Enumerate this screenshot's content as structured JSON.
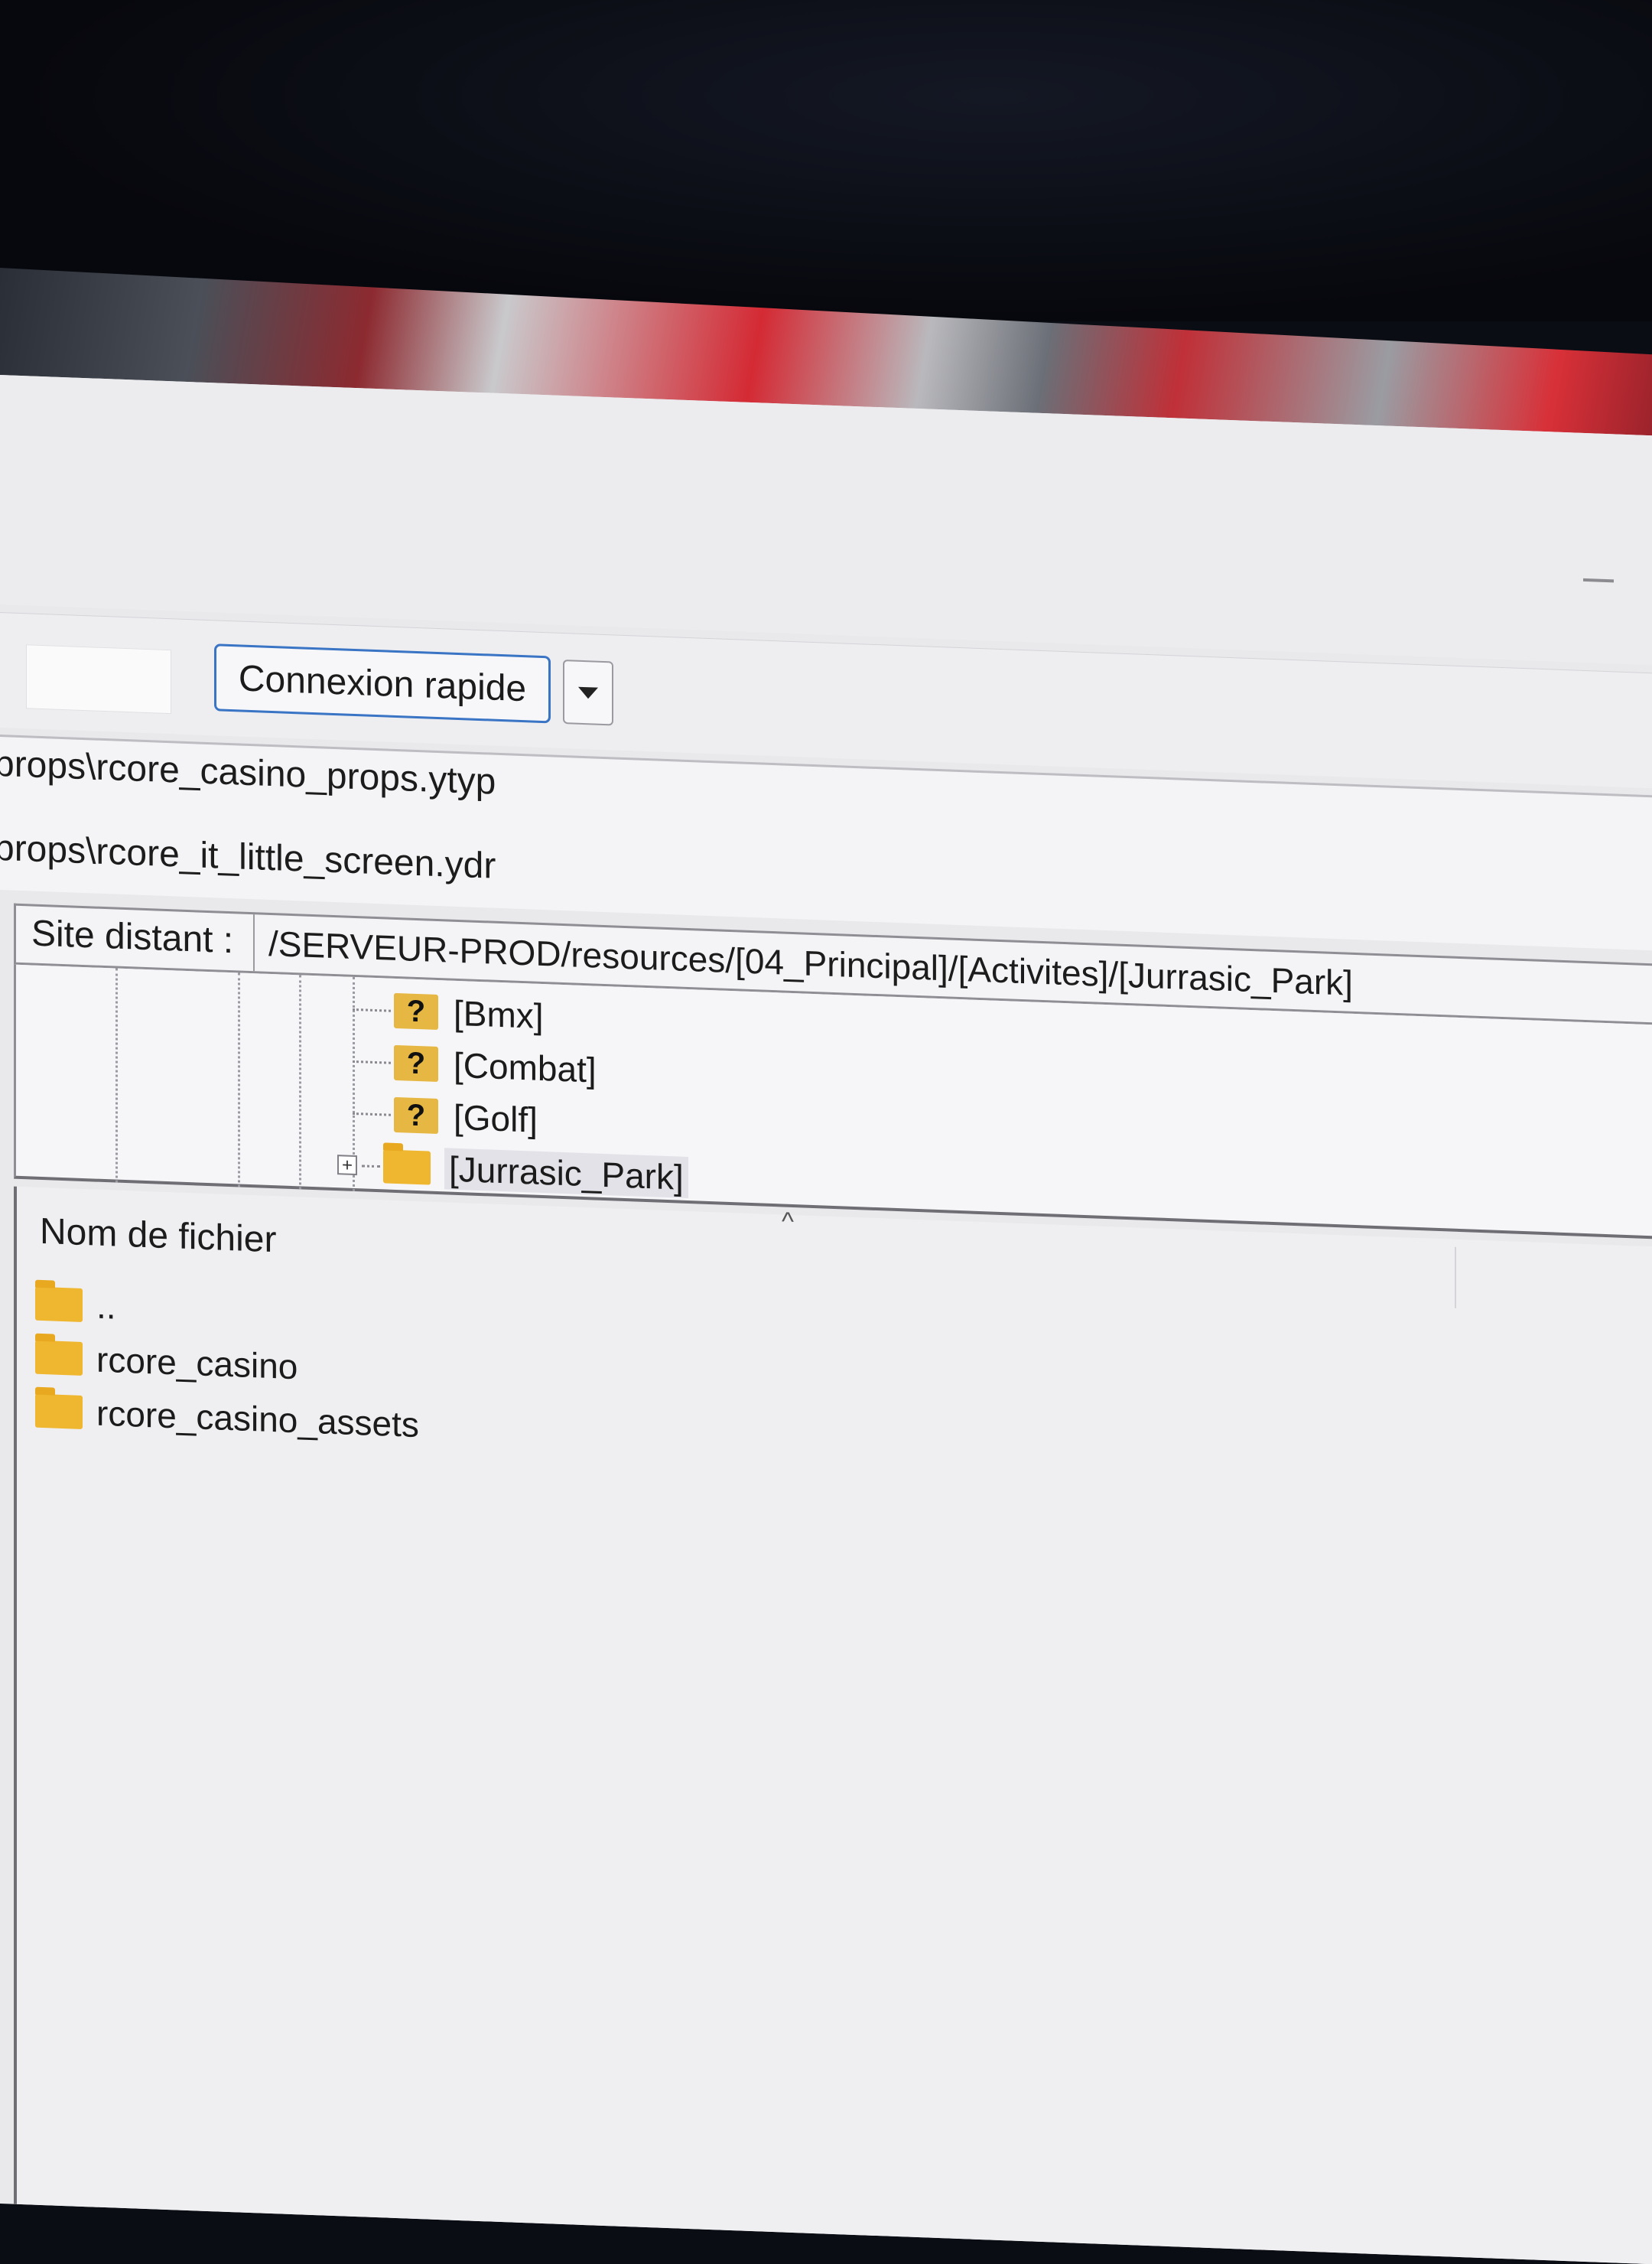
{
  "toolbar": {
    "quickconnect_label": "Connexion rapide"
  },
  "log": {
    "lines": [
      "props\\rcore_casino_props.ytyp",
      "props\\rcore_it_little_screen.ydr"
    ]
  },
  "remote": {
    "label": "Site distant :",
    "path": "/SERVEUR-PROD/resources/[04_Principal]/[Activites]/[Jurrasic_Park]"
  },
  "tree": {
    "items": [
      {
        "label": "[Bmx]",
        "icon": "unknown-folder-icon"
      },
      {
        "label": "[Combat]",
        "icon": "unknown-folder-icon"
      },
      {
        "label": "[Golf]",
        "icon": "unknown-folder-icon"
      },
      {
        "label": "[Jurrasic_Park]",
        "icon": "folder-icon"
      }
    ],
    "unknown_glyph": "?",
    "expand_glyph": "+"
  },
  "filelist": {
    "column_header": "Nom de fichier",
    "sort_glyph": "^",
    "rows": [
      {
        "name": ".."
      },
      {
        "name": "rcore_casino"
      },
      {
        "name": "rcore_casino_assets"
      }
    ]
  },
  "colors": {
    "accent": "#3a74c4",
    "folder": "#efb62f"
  }
}
